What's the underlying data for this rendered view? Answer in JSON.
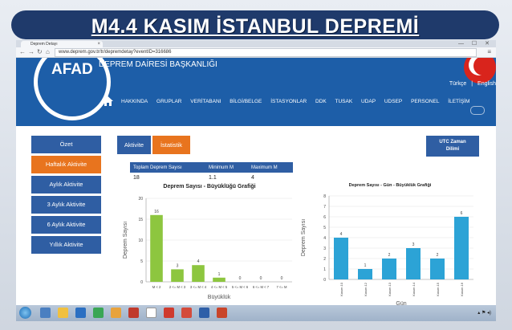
{
  "slide": {
    "title": "M4.4 KASIM İSTANBUL DEPREMİ"
  },
  "browser": {
    "tab_title": "Deprem Detayı",
    "url": "www.deprem.gov.tr/tr/depremdetay?eventID=316686",
    "window_controls": "— ☐ ✕"
  },
  "site": {
    "logo": "AFAD",
    "dept_name": "DEPREM DAİRESİ BAŞKANLIĞI",
    "lang_tr": "Türkçe",
    "lang_sep": "|",
    "lang_en": "English",
    "nav": [
      "HAKKINDA",
      "GRUPLAR",
      "VERİTABANI",
      "BİLGİ/BELGE",
      "İSTASYONLAR",
      "DDK",
      "TUSAK",
      "UDAP",
      "UDSEP",
      "PERSONEL",
      "İLETİŞİM"
    ]
  },
  "sidebar": [
    "Özet",
    "Haftalık Aktivite",
    "Aylık Aktivite",
    "3 Aylık Aktivite",
    "6 Aylık Aktivite",
    "Yıllık Aktivite"
  ],
  "tabs": {
    "aktivite": "Aktivite",
    "istatistik": "İstatistik",
    "utc_line1": "UTC Zaman",
    "utc_line2": "Dilimi"
  },
  "stats": {
    "headers": [
      "Toplam Deprem Sayısı",
      "Minimum M",
      "Maximum M"
    ],
    "values": [
      "18",
      "1.1",
      "4"
    ]
  },
  "colors": {
    "green_bar": "#8dc63f",
    "blue_bar": "#2ca3d6",
    "nav_blue": "#1d5ea8",
    "orange": "#e8741e"
  },
  "chart_data": [
    {
      "type": "bar",
      "title": "Deprem Sayısı - Büyüklüğü Grafiği",
      "xlabel": "Büyüklük",
      "ylabel": "Deprem Sayısı",
      "categories": [
        "M < 2",
        "2 <= M < 3",
        "3 <= M < 4",
        "4 <= M < 5",
        "5 <= M < 6",
        "6 <= M < 7",
        "7 <= M"
      ],
      "values": [
        16,
        3,
        4,
        1,
        0,
        0,
        0
      ],
      "ylim": [
        0,
        20
      ],
      "yticks": [
        0,
        5,
        10,
        15,
        20
      ],
      "grid": true
    },
    {
      "type": "bar",
      "title": "Deprem Sayısı - Gün - Büyüklük Grafiği",
      "xlabel": "Gün",
      "ylabel": "Deprem Sayısı",
      "categories": [
        "Kasım 10",
        "Kasım 12",
        "Kasım 13",
        "Kasım 14",
        "Kasım 15",
        "Kasım 16"
      ],
      "values": [
        4,
        1,
        2,
        3,
        2,
        6
      ],
      "ylim": [
        0,
        8
      ],
      "yticks": [
        0,
        1,
        2,
        3,
        4,
        5,
        6,
        7,
        8
      ],
      "grid": true
    }
  ]
}
